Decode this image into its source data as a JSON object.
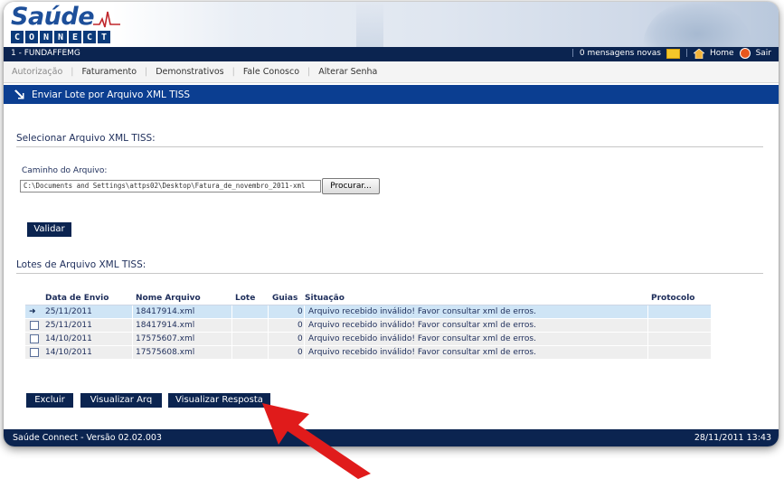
{
  "logo": {
    "title": "Saúde",
    "subtitle_letters": [
      "C",
      "O",
      "N",
      "N",
      "E",
      "C",
      "T"
    ]
  },
  "topbar": {
    "org": "1 - FUNDAFFEMG",
    "messages": "0 mensagens novas",
    "home": "Home",
    "logout": "Sair"
  },
  "menu": {
    "items": [
      "Autorização",
      "Faturamento",
      "Demonstrativos",
      "Fale Conosco",
      "Alterar Senha"
    ]
  },
  "section": {
    "title": "Enviar Lote por Arquivo XML TISS"
  },
  "upload": {
    "heading": "Selecionar Arquivo XML TISS:",
    "path_label": "Caminho do Arquivo:",
    "path_value": "C:\\Documents and Settings\\attps02\\Desktop\\Fatura_de_novembro_2011-xml",
    "browse_label": "Procurar...",
    "validate_label": "Validar"
  },
  "lots": {
    "heading": "Lotes de Arquivo XML TISS:",
    "columns": [
      "Data de Envio",
      "Nome Arquivo",
      "Lote",
      "Guias",
      "Situação",
      "Protocolo"
    ],
    "rows": [
      {
        "date": "25/11/2011",
        "file": "18417914.xml",
        "lote": "",
        "guias": "0",
        "status": "Arquivo recebido inválido! Favor consultar xml de erros.",
        "protocolo": ""
      },
      {
        "date": "25/11/2011",
        "file": "18417914.xml",
        "lote": "",
        "guias": "0",
        "status": "Arquivo recebido inválido! Favor consultar xml de erros.",
        "protocolo": ""
      },
      {
        "date": "14/10/2011",
        "file": "17575607.xml",
        "lote": "",
        "guias": "0",
        "status": "Arquivo recebido inválido! Favor consultar xml de erros.",
        "protocolo": ""
      },
      {
        "date": "14/10/2011",
        "file": "17575608.xml",
        "lote": "",
        "guias": "0",
        "status": "Arquivo recebido inválido! Favor consultar xml de erros.",
        "protocolo": ""
      }
    ],
    "selected_row": 0
  },
  "actions": {
    "delete_label": "Excluir",
    "view_file_label": "Visualizar Arq",
    "view_response_label": "Visualizar Resposta"
  },
  "footer": {
    "version": "Saúde Connect - Versão 02.02.003",
    "datetime": "28/11/2011 13:43"
  },
  "colors": {
    "navy": "#0b2450",
    "section_blue": "#0b3e91",
    "selected_row": "#cfe5f6",
    "annotation_arrow": "#e01b1b"
  }
}
